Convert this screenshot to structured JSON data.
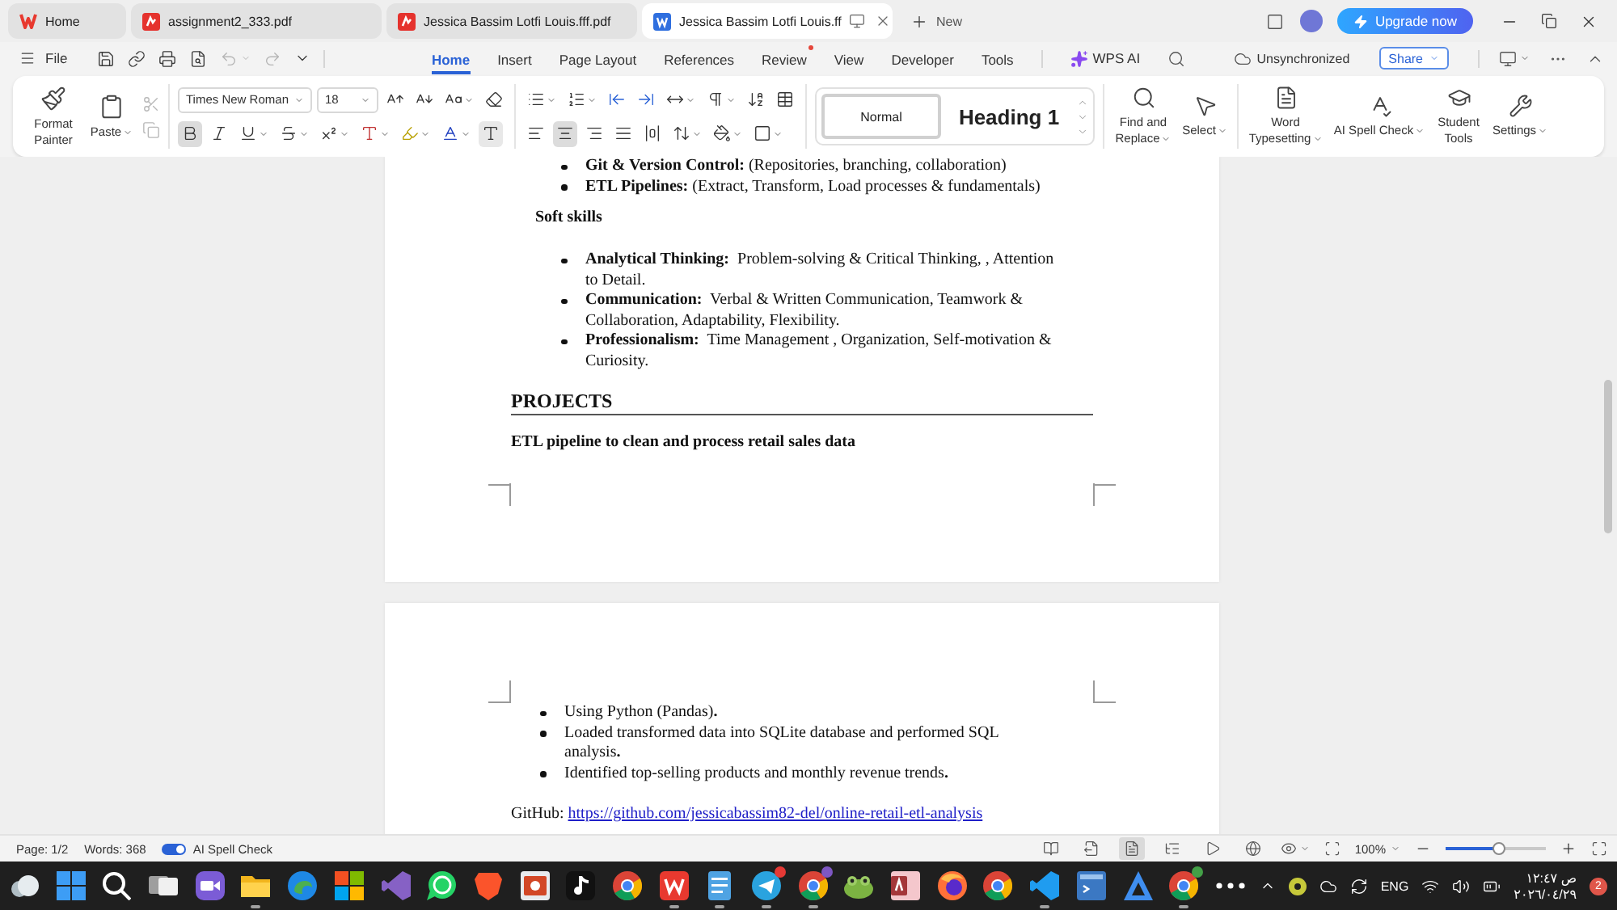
{
  "tabs": [
    {
      "kind": "home",
      "label": "Home",
      "selected": false
    },
    {
      "kind": "pdf",
      "label": "assignment2_333.pdf",
      "selected": false
    },
    {
      "kind": "pdf",
      "label": "Jessica Bassim Lotfi Louis.fff.pdf",
      "selected": false
    },
    {
      "kind": "writer",
      "label": "Jessica Bassim Lotfi Louis.ff",
      "selected": true
    }
  ],
  "new_tab": "New",
  "upgrade": "Upgrade now",
  "menu": {
    "file": "File",
    "undo": {
      "disabled": true
    },
    "redo": {
      "disabled": true
    },
    "tabs": [
      {
        "label": "Home",
        "selected": true,
        "dot": false
      },
      {
        "label": "Insert",
        "selected": false,
        "dot": false
      },
      {
        "label": "Page Layout",
        "selected": false,
        "dot": false
      },
      {
        "label": "References",
        "selected": false,
        "dot": false
      },
      {
        "label": "Review",
        "selected": false,
        "dot": true
      },
      {
        "label": "View",
        "selected": false,
        "dot": false
      },
      {
        "label": "Developer",
        "selected": false,
        "dot": false
      },
      {
        "label": "Tools",
        "selected": false,
        "dot": false
      }
    ],
    "ai": "WPS AI",
    "sync": "Unsynchronized",
    "share": "Share"
  },
  "ribbon": {
    "format_painter": "Format Painter",
    "paste": "Paste",
    "cut": {
      "disabled": true
    },
    "copy": {
      "disabled": true
    },
    "font_family": "Times New Roman",
    "font_size": "18",
    "formats": [
      {
        "kind": "bold",
        "selected": true
      },
      {
        "kind": "italic",
        "selected": false
      },
      {
        "kind": "underline",
        "selected": false
      },
      {
        "kind": "strikethrough",
        "selected": false
      },
      {
        "kind": "superscript",
        "selected": false
      },
      {
        "kind": "effects",
        "selected": false
      },
      {
        "kind": "highlight",
        "selected": false
      },
      {
        "kind": "font_color",
        "selected": false
      },
      {
        "kind": "shading",
        "selected": false
      }
    ],
    "alignments": [
      {
        "kind": "left",
        "selected": false
      },
      {
        "kind": "center",
        "selected": true
      },
      {
        "kind": "right",
        "selected": false
      },
      {
        "kind": "justify",
        "selected": false
      },
      {
        "kind": "distributed",
        "selected": false
      }
    ],
    "styles": [
      {
        "kind": "normal",
        "label": "Normal",
        "selected": true
      },
      {
        "kind": "heading",
        "label": "Heading 1",
        "selected": false
      }
    ],
    "tools": [
      {
        "kind": "find",
        "label": "Find and Replace",
        "dropdown": true
      },
      {
        "kind": "select",
        "label": "Select",
        "dropdown": true
      },
      {
        "kind": "typesetting",
        "label": "Word Typesetting",
        "dropdown": true
      },
      {
        "kind": "spell",
        "label": "AI Spell Check",
        "dropdown": true
      },
      {
        "kind": "student",
        "label": "Student Tools",
        "dropdown": false
      },
      {
        "kind": "settings",
        "label": "Settings",
        "dropdown": true
      }
    ]
  },
  "document": {
    "pages": [
      {
        "blocks": [
          {
            "kind": "skill_list",
            "items": [
              "**Git & Version Control:** (Repositories, branching, collaboration)",
              "**ETL Pipelines:** (Extract, Transform, Load processes & fundamentals)"
            ]
          },
          {
            "kind": "subsection",
            "title": "Soft skills",
            "items": [
              "**Analytical Thinking:**  Problem-solving & Critical Thinking, , Attention to Detail.",
              "**Communication:**  Verbal & Written Communication, Teamwork & Collaboration, Adaptability, Flexibility.",
              "**Professionalism:**  Time Management , Organization, Self-motivation & Curiosity."
            ]
          },
          {
            "kind": "heading",
            "text": "PROJECTS"
          },
          {
            "kind": "project",
            "text": "ETL pipeline to clean and process retail sales data"
          }
        ]
      },
      {
        "blocks": [
          {
            "kind": "project_list",
            "items": [
              "Using Python (Pandas)**.**",
              "Loaded transformed data into SQLite database and performed SQL analysis**.**",
              "Identified top-selling products and monthly revenue trends**.**"
            ]
          },
          {
            "kind": "link",
            "label": "GitHub:",
            "url": "https://github.com/jessicabassim82-del/online-retail-etl-analysis"
          }
        ]
      }
    ]
  },
  "status_bar": {
    "page": "Page: 1/2",
    "words": "Words: 368",
    "spell_check": {
      "label": "AI Spell Check",
      "on": true
    },
    "views": [
      {
        "kind": "read",
        "selected": false
      },
      {
        "kind": "export",
        "selected": false
      },
      {
        "kind": "page",
        "selected": true
      },
      {
        "kind": "outline",
        "selected": false
      },
      {
        "kind": "play",
        "selected": false
      },
      {
        "kind": "web",
        "selected": false
      }
    ],
    "zoom": "100%",
    "zoom_slider": {
      "level": 0.53
    }
  },
  "taskbar": {
    "apps": [
      {
        "kind": "weather",
        "running": false
      },
      {
        "kind": "start",
        "running": false
      },
      {
        "kind": "search",
        "running": false
      },
      {
        "kind": "taskview",
        "running": false
      },
      {
        "kind": "meet",
        "running": false
      },
      {
        "kind": "files",
        "running": true
      },
      {
        "kind": "edge",
        "running": false
      },
      {
        "kind": "tiles",
        "running": false
      },
      {
        "kind": "vs",
        "running": false
      },
      {
        "kind": "chat",
        "running": false
      },
      {
        "kind": "shield",
        "running": false
      },
      {
        "kind": "slides",
        "running": false
      },
      {
        "kind": "note",
        "running": false
      },
      {
        "kind": "chrome",
        "running": false
      },
      {
        "kind": "suite",
        "running": true
      },
      {
        "kind": "notepad",
        "running": true
      },
      {
        "kind": "send",
        "running": true,
        "badge": {
          "color": "#e53935"
        }
      },
      {
        "kind": "chrome",
        "running": true,
        "badge": {
          "color": "#7e57c2"
        }
      },
      {
        "kind": "frog",
        "running": false
      },
      {
        "kind": "database",
        "running": false
      },
      {
        "kind": "firefox",
        "running": false
      },
      {
        "kind": "chrome",
        "running": false
      },
      {
        "kind": "vscode",
        "running": true
      },
      {
        "kind": "terminal",
        "running": false
      },
      {
        "kind": "triangle",
        "running": false
      },
      {
        "kind": "chrome",
        "running": true,
        "badge": {
          "color": "#43a047"
        }
      },
      {
        "kind": "more",
        "running": false
      }
    ],
    "language": "ENG",
    "time": "١٢:٤٧ ص",
    "date": "٢٠٢٦/٠٤/٢٩",
    "notifications": "2"
  }
}
